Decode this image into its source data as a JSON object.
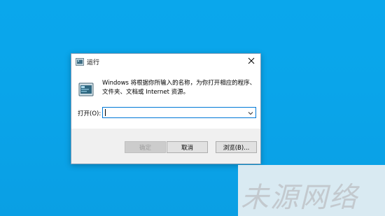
{
  "dialog": {
    "title": "运行",
    "description": "Windows 将根据你所输入的名称，为你打开相应的程序、文件夹、文档或 Internet 资源。",
    "open_label": "打开(O):",
    "open_value": ""
  },
  "buttons": {
    "ok": "确定",
    "cancel": "取消",
    "browse": "浏览(B)..."
  },
  "watermark": {
    "text": "未源网络"
  },
  "colors": {
    "desktop": "#0aa5ea",
    "focus_border": "#0078d7",
    "button_bar": "#f0f0f0"
  },
  "icons": [
    "run-icon",
    "run-program-icon",
    "close-icon",
    "chevron-down-icon"
  ]
}
